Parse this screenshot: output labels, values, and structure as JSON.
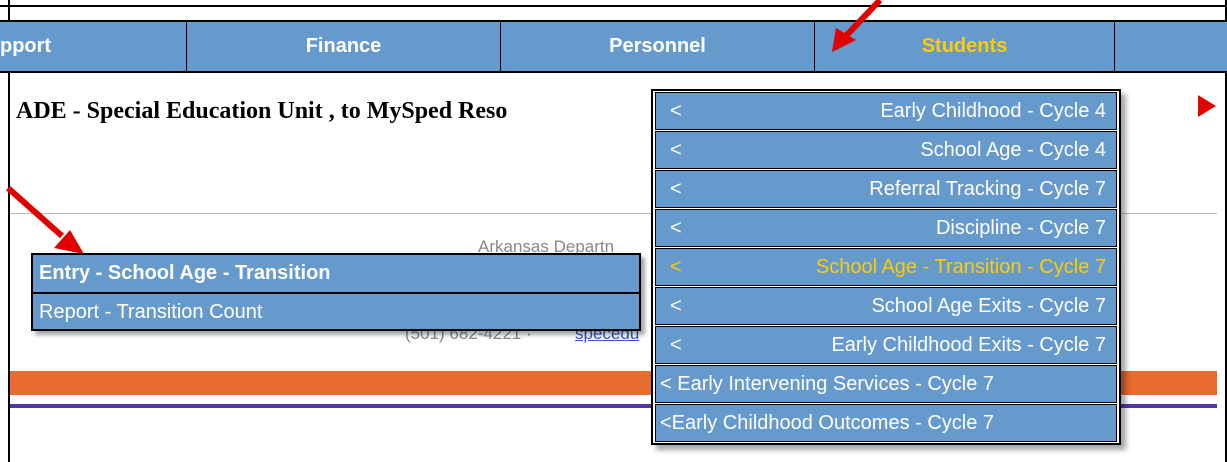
{
  "nav": {
    "tabs": [
      {
        "label": "pport"
      },
      {
        "label": "Finance"
      },
      {
        "label": "Personnel"
      },
      {
        "label": "Students"
      }
    ]
  },
  "headline": "ADE - Special Education Unit , to MySped Reso",
  "footer": {
    "line1": "Arkansas Departn",
    "line2": "(501) 682-4221 · ",
    "link": "specedu"
  },
  "submenu": {
    "items": [
      {
        "label": "Entry - School Age - Transition"
      },
      {
        "label": "Report - Transition Count"
      }
    ]
  },
  "dropdown": {
    "chevron": "<",
    "items": [
      {
        "label": "Early Childhood - Cycle 4"
      },
      {
        "label": "School Age - Cycle 4"
      },
      {
        "label": "Referral Tracking - Cycle 7"
      },
      {
        "label": "Discipline - Cycle 7"
      },
      {
        "label": "School Age - Transition - Cycle 7"
      },
      {
        "label": "School Age Exits - Cycle 7"
      },
      {
        "label": "Early Childhood Exits - Cycle 7"
      },
      {
        "label": "< Early Intervening Services - Cycle 7"
      },
      {
        "label": "<Early Childhood Outcomes - Cycle 7"
      }
    ]
  },
  "colors": {
    "nav_bg": "#6699cc",
    "active_text": "#ffcc00",
    "annotation_arrow": "#e00000",
    "orange_bar": "#e86b30",
    "purple_line": "#5533aa"
  }
}
